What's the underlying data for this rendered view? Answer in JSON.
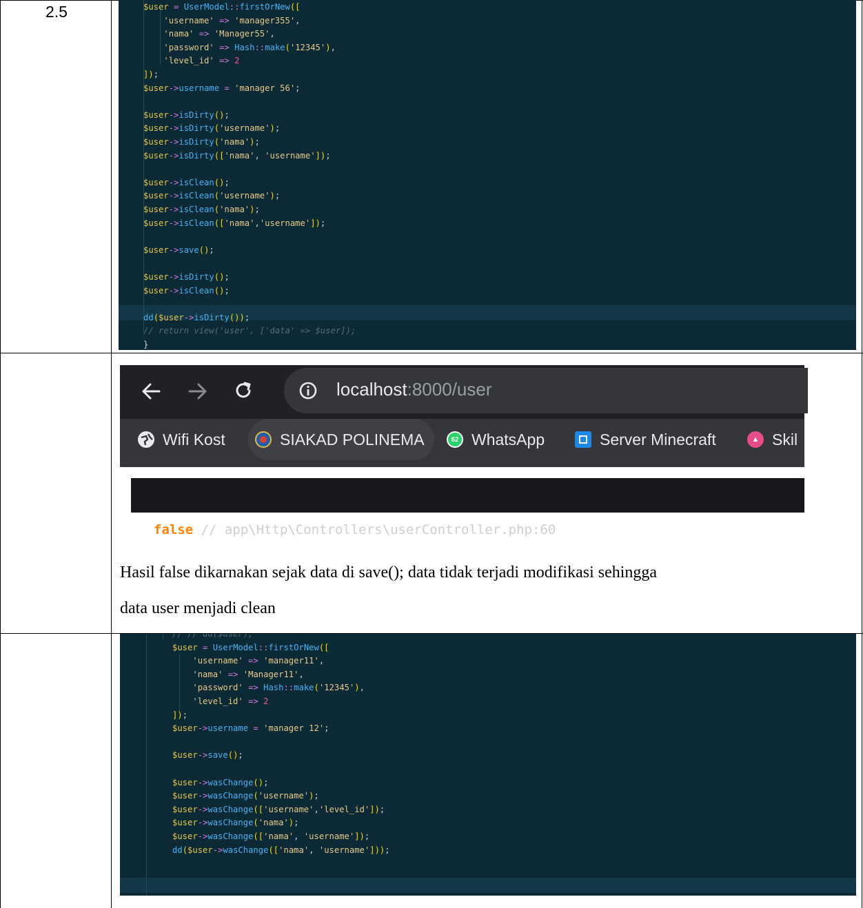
{
  "row1": {
    "number": "2.5",
    "code_lines": [
      "$user = UserModel::firstOrNew([",
      "    'username' => 'manager355',",
      "    'nama' => 'Manager55',",
      "    'password' => Hash::make('12345'),",
      "    'level_id' => 2",
      "]);",
      "$user->username = 'manager 56';",
      "",
      "$user->isDirty();",
      "$user->isDirty('username');",
      "$user->isDirty('nama');",
      "$user->isDirty(['nama', 'username']);",
      "",
      "$user->isClean();",
      "$user->isClean('username');",
      "$user->isClean('nama');",
      "$user->isClean(['nama','username']);",
      "",
      "$user->save();",
      "",
      "$user->isDirty();",
      "$user->isClean();",
      "",
      "dd($user->isDirty());",
      "// return view('user', ['data' => $user]);",
      "}"
    ]
  },
  "row2": {
    "browser": {
      "back_icon": "arrow-left-icon",
      "forward_icon": "arrow-right-icon",
      "reload_icon": "reload-icon",
      "info_icon": "info-icon",
      "url_host": "localhost",
      "url_rest": ":8000/user",
      "bookmarks": [
        {
          "label": "Wifi Kost",
          "icon": "globe-icon"
        },
        {
          "label": "SIAKAD POLINEMA",
          "icon": "polinema-logo-icon"
        },
        {
          "label": "WhatsApp",
          "icon": "whatsapp-icon",
          "badge": "62"
        },
        {
          "label": "Server Minecraft",
          "icon": "server-icon"
        },
        {
          "label": "Skil",
          "icon": "skill-icon"
        }
      ]
    },
    "dump": {
      "value": "false",
      "comment": " // app\\Http\\Controllers\\userController.php:60"
    },
    "paragraph_line1": "Hasil false dikarnakan sejak data di save(); data tidak terjadi modifikasi sehingga",
    "paragraph_line2": "data user menjadi clean"
  },
  "row3": {
    "code_lines": [
      "// // dd($user);",
      "$user = UserModel::firstOrNew([",
      "    'username' => 'manager11',",
      "    'nama' => 'Manager11',",
      "    'password' => Hash::make('12345'),",
      "    'level_id' => 2",
      "]);",
      "$user->username = 'manager 12';",
      "",
      "$user->save();",
      "",
      "$user->wasChange();",
      "$user->wasChange('username');",
      "$user->wasChange(['username','level_id']);",
      "$user->wasChange('nama');",
      "$user->wasChange(['nama', 'username']);",
      "dd($user->wasChange(['nama', 'username']));"
    ]
  }
}
